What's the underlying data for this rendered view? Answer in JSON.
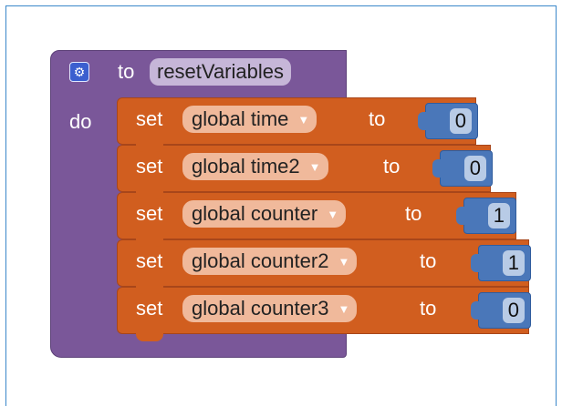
{
  "procedure": {
    "to_keyword": "to",
    "name": "resetVariables",
    "do_keyword": "do",
    "gear_icon": "gear-icon"
  },
  "statements": [
    {
      "set_keyword": "set",
      "variable": "global time",
      "to_keyword": "to",
      "value": "0"
    },
    {
      "set_keyword": "set",
      "variable": "global time2",
      "to_keyword": "to",
      "value": "0"
    },
    {
      "set_keyword": "set",
      "variable": "global counter",
      "to_keyword": "to",
      "value": "1"
    },
    {
      "set_keyword": "set",
      "variable": "global counter2",
      "to_keyword": "to",
      "value": "1"
    },
    {
      "set_keyword": "set",
      "variable": "global counter3",
      "to_keyword": "to",
      "value": "0"
    }
  ],
  "colors": {
    "procedure": "#7a5799",
    "set_block": "#d15e1f",
    "number_block": "#4a77b9",
    "frame_border": "#3a87c9"
  }
}
